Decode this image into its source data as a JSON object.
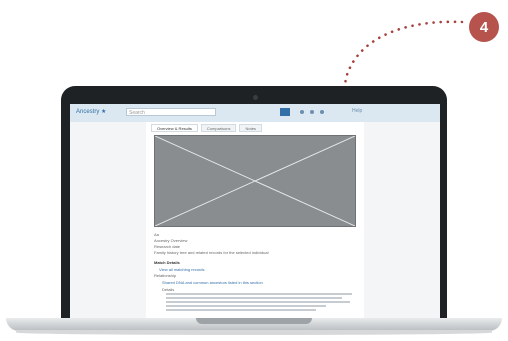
{
  "step_badge": {
    "label": "4"
  },
  "colors": {
    "badge": "#b5534c",
    "arrow": "#a4443e",
    "accent": "#3470a8"
  },
  "app": {
    "brand": "Ancestry ★",
    "search": {
      "placeholder": "Search"
    },
    "topbar_links": [
      "Help"
    ]
  },
  "tabs": [
    {
      "label": "Overview & Results"
    },
    {
      "label": "Comparisons"
    },
    {
      "label": "Notes"
    }
  ],
  "content": {
    "lines": [
      "Aa",
      "Ancestry Overview",
      "Research date",
      "Family history tree and related records for the selected individual",
      "Match Details",
      "View all matching records",
      "Relationship",
      "Shared DNA and common ancestors listed in this section",
      "Details"
    ]
  }
}
